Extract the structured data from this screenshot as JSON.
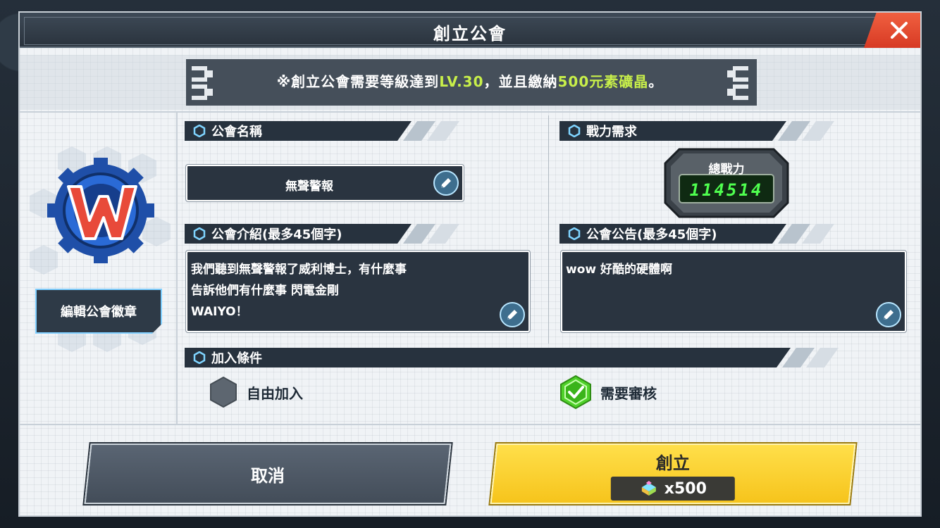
{
  "dialog": {
    "title": "創立公會"
  },
  "notice": {
    "prefix": "※創立公會需要等級達到",
    "level": "LV.30",
    "middle": "，並且繳納",
    "cost_text": "500元素礦晶",
    "suffix": "。"
  },
  "emblem": {
    "letter": "W",
    "edit_label": "編輯公會徽章"
  },
  "guild_name": {
    "header": "公會名稱",
    "value": "無聲警報"
  },
  "power": {
    "header": "戰力需求",
    "badge_label": "總戰力",
    "value": "114514"
  },
  "intro": {
    "header": "公會介紹(最多45個字)",
    "lines": [
      "我們聽到無聲警報了威利博士，有什麼事",
      "告訴他們有什麼事 閃電金剛",
      "WAIYO！"
    ]
  },
  "announcement": {
    "header": "公會公告(最多45個字)",
    "value": "wow 好酷的硬體啊"
  },
  "join": {
    "header": "加入條件",
    "option_free": "自由加入",
    "option_review": "需要審核",
    "selected": "需要審核"
  },
  "buttons": {
    "cancel": "取消",
    "create": "創立",
    "cost": "x500"
  },
  "colors": {
    "highlight": "#c8ef4a",
    "create_button": "#f6c41c",
    "check_green": "#4fd12a",
    "close_button": "#e04a30"
  }
}
